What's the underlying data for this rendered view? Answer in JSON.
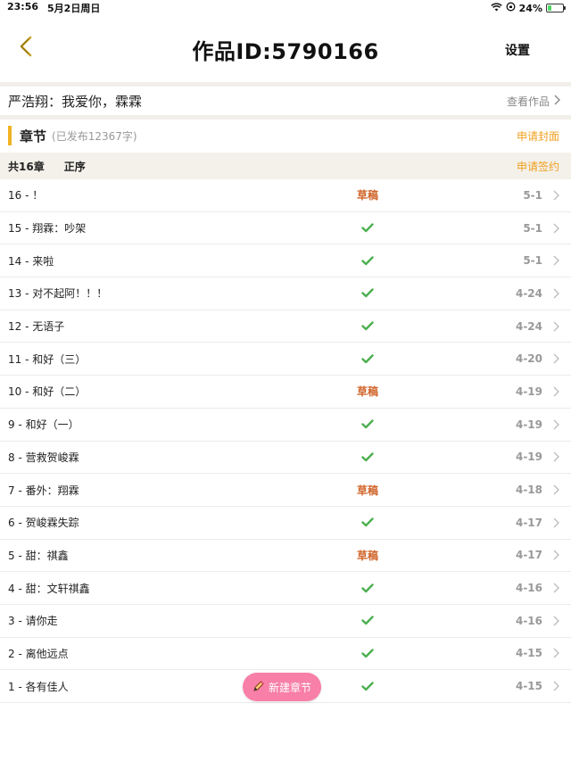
{
  "status_bar": {
    "time": "23:56",
    "date": "5月2日周日",
    "battery": "24%",
    "battery_level": 0.24
  },
  "nav": {
    "title": "作品ID:5790166",
    "settings_label": "设置"
  },
  "work": {
    "title": "严浩翔：我爱你，霖霖",
    "view_label": "查看作品"
  },
  "section": {
    "title": "章节",
    "published_info": "(已发布12367字)",
    "apply_cover_label": "申请封面"
  },
  "summary": {
    "count_label": "共16章",
    "sort_label": "正序",
    "apply_sign_label": "申请签约"
  },
  "chapters": [
    {
      "title": "16 - ！",
      "status": "draft",
      "status_label": "草稿",
      "date": "5-1"
    },
    {
      "title": "15 - 翔霖：吵架",
      "status": "published",
      "status_label": "",
      "date": "5-1"
    },
    {
      "title": "14 - 来啦",
      "status": "published",
      "status_label": "",
      "date": "5-1"
    },
    {
      "title": "13 - 对不起阿！！！",
      "status": "published",
      "status_label": "",
      "date": "4-24"
    },
    {
      "title": "12 - 无语子",
      "status": "published",
      "status_label": "",
      "date": "4-24"
    },
    {
      "title": "11 - 和好（三）",
      "status": "published",
      "status_label": "",
      "date": "4-20"
    },
    {
      "title": "10 - 和好（二）",
      "status": "draft",
      "status_label": "草稿",
      "date": "4-19"
    },
    {
      "title": "9 - 和好（一）",
      "status": "published",
      "status_label": "",
      "date": "4-19"
    },
    {
      "title": "8 - 营救贺峻霖",
      "status": "published",
      "status_label": "",
      "date": "4-19"
    },
    {
      "title": "7 - 番外：翔霖",
      "status": "draft",
      "status_label": "草稿",
      "date": "4-18"
    },
    {
      "title": "6 - 贺峻霖失踪",
      "status": "published",
      "status_label": "",
      "date": "4-17"
    },
    {
      "title": "5 - 甜：祺鑫",
      "status": "draft",
      "status_label": "草稿",
      "date": "4-17"
    },
    {
      "title": "4 - 甜：文轩祺鑫",
      "status": "published",
      "status_label": "",
      "date": "4-16"
    },
    {
      "title": "3 - 请你走",
      "status": "published",
      "status_label": "",
      "date": "4-16"
    },
    {
      "title": "2 - 离他远点",
      "status": "published",
      "status_label": "",
      "date": "4-15"
    },
    {
      "title": "1 - 各有佳人",
      "status": "published",
      "status_label": "",
      "date": "4-15"
    }
  ],
  "new_chapter_label": "新建章节",
  "colors": {
    "accent_orange": "#f0a020",
    "accent_bar": "#f0b323",
    "draft": "#d0642a",
    "published_check": "#4caf50",
    "new_button": "#f77fa8"
  }
}
